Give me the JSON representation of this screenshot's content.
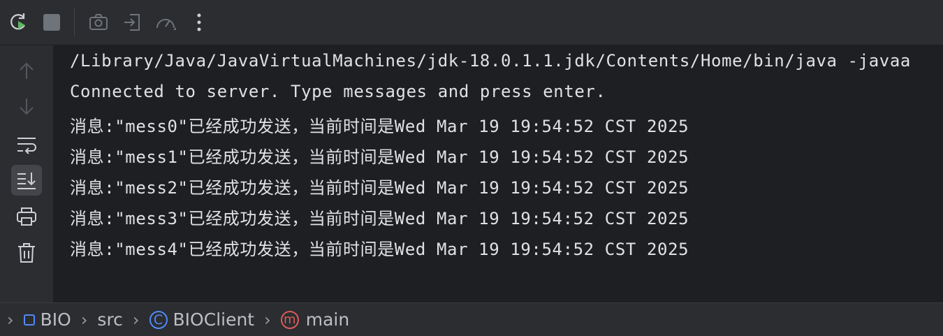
{
  "toolbar": {
    "icons": [
      "rerun-icon",
      "stop-icon",
      "camera-icon",
      "exit-icon",
      "speedometer-icon",
      "more-vertical-icon"
    ]
  },
  "sidebar": {
    "icons": [
      "arrow-up-icon",
      "arrow-down-icon",
      "soft-wrap-icon",
      "scroll-to-end-icon",
      "print-icon",
      "trash-icon"
    ],
    "active": "scroll-to-end-icon"
  },
  "console": {
    "lines": [
      "/Library/Java/JavaVirtualMachines/jdk-18.0.1.1.jdk/Contents/Home/bin/java -javaa",
      "Connected to server. Type messages and press enter.",
      "消息:\"mess0\"已经成功发送，当前时间是Wed Mar 19 19:54:52 CST 2025",
      "消息:\"mess1\"已经成功发送，当前时间是Wed Mar 19 19:54:52 CST 2025",
      "消息:\"mess2\"已经成功发送，当前时间是Wed Mar 19 19:54:52 CST 2025",
      "消息:\"mess3\"已经成功发送，当前时间是Wed Mar 19 19:54:52 CST 2025",
      "消息:\"mess4\"已经成功发送，当前时间是Wed Mar 19 19:54:52 CST 2025"
    ]
  },
  "breadcrumb": {
    "items": [
      {
        "label": "BIO",
        "icon": "module-icon"
      },
      {
        "label": "src",
        "icon": ""
      },
      {
        "label": "BIOClient",
        "icon": "class-icon",
        "icon_text": "C"
      },
      {
        "label": "main",
        "icon": "method-icon",
        "icon_text": "m"
      }
    ]
  },
  "colors": {
    "background": "#1e1f22",
    "panel": "#2b2d30",
    "text": "#dfe1e5",
    "rerun_green": "#5fb865",
    "class_blue": "#548af7",
    "method_red": "#db5c5c"
  }
}
